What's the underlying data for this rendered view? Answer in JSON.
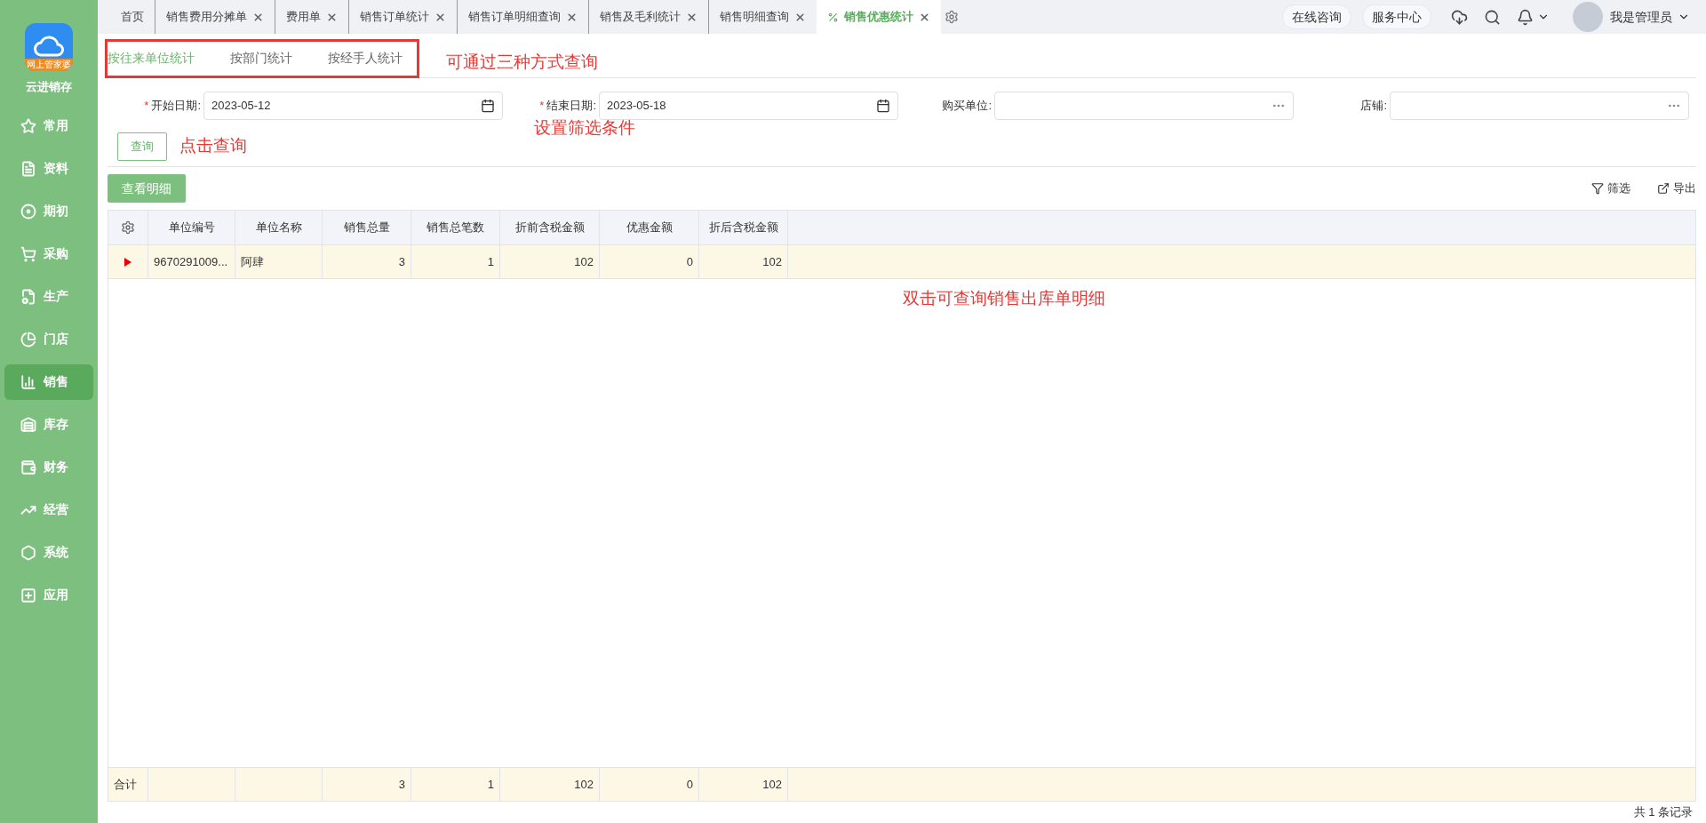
{
  "app": {
    "name": "云进销存",
    "logo_badge": "网上管家婆"
  },
  "sidebar": {
    "items": [
      {
        "label": "常用",
        "selected": false
      },
      {
        "label": "资料",
        "selected": false
      },
      {
        "label": "期初",
        "selected": false
      },
      {
        "label": "采购",
        "selected": false
      },
      {
        "label": "生产",
        "selected": false
      },
      {
        "label": "门店",
        "selected": false
      },
      {
        "label": "销售",
        "selected": true
      },
      {
        "label": "库存",
        "selected": false
      },
      {
        "label": "财务",
        "selected": false
      },
      {
        "label": "经营",
        "selected": false
      },
      {
        "label": "系统",
        "selected": false
      },
      {
        "label": "应用",
        "selected": false
      }
    ]
  },
  "tabs": [
    {
      "label": "首页",
      "closable": false,
      "selected": false
    },
    {
      "label": "销售费用分摊单",
      "closable": true,
      "selected": false
    },
    {
      "label": "费用单",
      "closable": true,
      "selected": false
    },
    {
      "label": "销售订单统计",
      "closable": true,
      "selected": false
    },
    {
      "label": "销售订单明细查询",
      "closable": true,
      "selected": false
    },
    {
      "label": "销售及毛利统计",
      "closable": true,
      "selected": false
    },
    {
      "label": "销售明细查询",
      "closable": true,
      "selected": false
    },
    {
      "label": "销售优惠统计",
      "closable": true,
      "selected": true
    }
  ],
  "header": {
    "buttons": [
      "在线咨询",
      "服务中心"
    ],
    "user": "我是管理员"
  },
  "modes": [
    {
      "label": "按往来单位统计",
      "selected": true
    },
    {
      "label": "按部门统计",
      "selected": false
    },
    {
      "label": "按经手人统计",
      "selected": false
    }
  ],
  "filters": [
    {
      "kind": "date",
      "label": "开始日期:",
      "required": true,
      "value": "2023-05-12"
    },
    {
      "kind": "date",
      "label": "结束日期:",
      "required": true,
      "value": "2023-05-18"
    },
    {
      "kind": "picker",
      "label": "购买单位:",
      "required": false
    },
    {
      "kind": "picker",
      "label": "店铺:",
      "required": false
    }
  ],
  "required_mark": "*",
  "query_button": "查询",
  "detail_button": "查看明细",
  "toolbar": [
    "筛选",
    "导出"
  ],
  "table": {
    "columns": [
      "单位编号",
      "单位名称",
      "销售总量",
      "销售总笔数",
      "折前含税金额",
      "优惠金额",
      "折后含税金额"
    ],
    "rows": [
      {
        "selected": true,
        "cells": [
          "9670291009...",
          "阿肆",
          "3",
          "1",
          "102",
          "0",
          "102"
        ]
      }
    ],
    "total": {
      "label": "合计",
      "values": [
        "3",
        "1",
        "102",
        "0",
        "102"
      ]
    }
  },
  "footer": "共 1 条记录",
  "annotations": [
    "可通过三种方式查询",
    "点击查询",
    "设置筛选条件",
    "双击可查询销售出库单明细"
  ]
}
